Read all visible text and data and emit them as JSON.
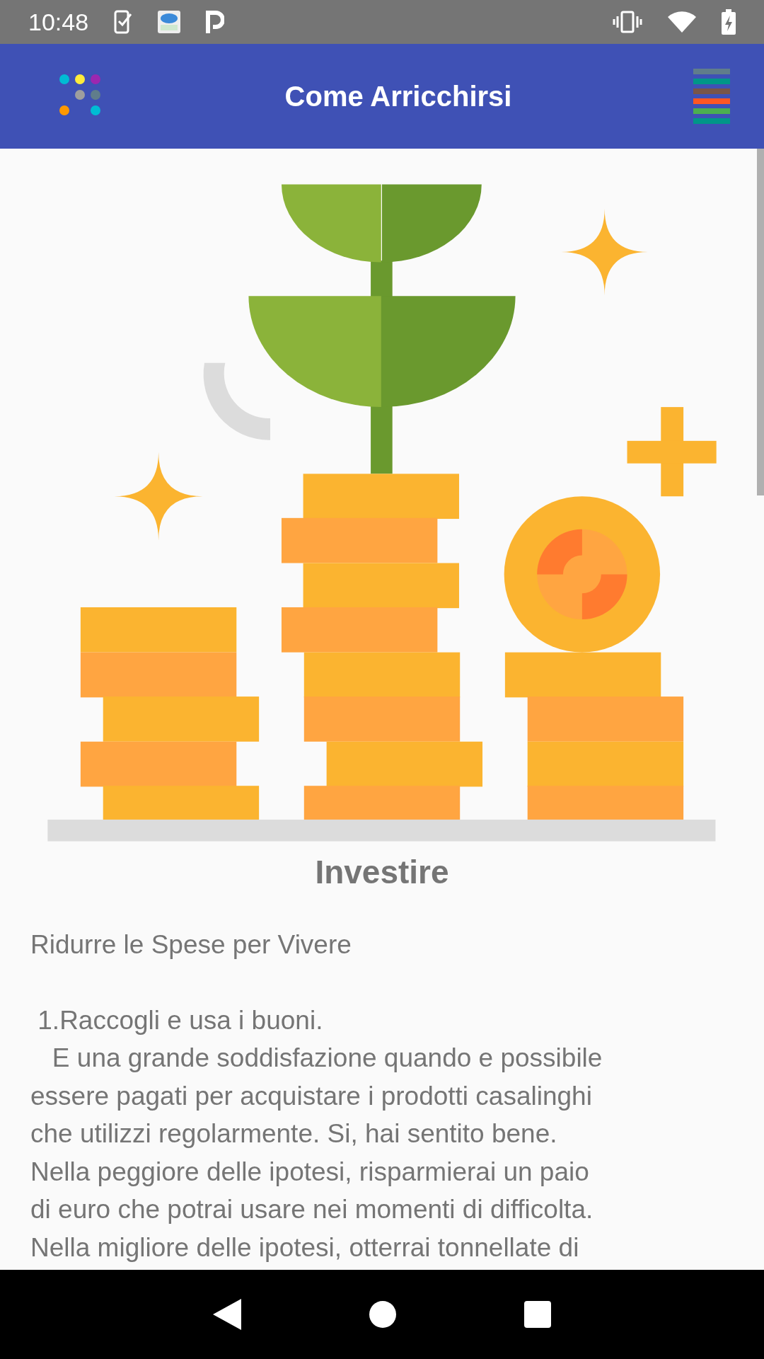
{
  "status_bar": {
    "time": "10:48"
  },
  "app_bar": {
    "title": "Come Arricchirsi"
  },
  "article": {
    "title": "Investire",
    "subtitle": "Ridurre le Spese per Vivere",
    "lines": [
      " 1.Raccogli e usa i buoni.",
      "   E una grande soddisfazione quando e possibile",
      "essere pagati per acquistare i prodotti casalinghi",
      "che utilizzi regolarmente. Si, hai sentito bene.",
      "Nella peggiore delle ipotesi, risparmierai un paio",
      "di euro che potrai usare nei momenti di difficolta.",
      "Nella migliore delle ipotesi, otterrai tonnellate di"
    ]
  }
}
